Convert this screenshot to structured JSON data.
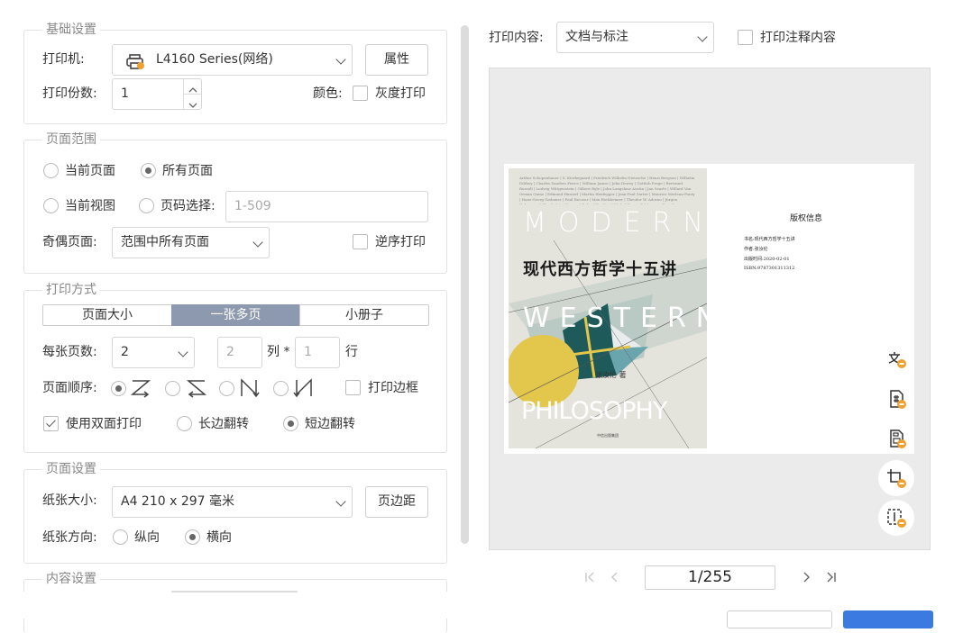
{
  "basic": {
    "legend": "基础设置",
    "printer_label": "打印机:",
    "printer_value": "L4160 Series(网络)",
    "properties_button": "属性",
    "copies_label": "打印份数:",
    "copies_value": "1",
    "color_label": "颜色:",
    "grayscale_label": "灰度打印"
  },
  "page_range": {
    "legend": "页面范围",
    "current_page": "当前页面",
    "all_pages": "所有页面",
    "current_view": "当前视图",
    "page_select": "页码选择:",
    "page_select_placeholder": "1-509",
    "odd_even_label": "奇偶页面:",
    "odd_even_value": "范围中所有页面",
    "reverse_label": "逆序打印"
  },
  "print_mode": {
    "legend": "打印方式",
    "tabs": [
      "页面大小",
      "一张多页",
      "小册子"
    ],
    "active_tab": "一张多页",
    "pages_per_sheet_label": "每张页数:",
    "pages_per_sheet_value": "2",
    "columns_value": "2",
    "columns_label": "列 *",
    "rows_value": "1",
    "rows_label": "行",
    "page_order_label": "页面顺序:",
    "print_border_label": "打印边框",
    "duplex_label": "使用双面打印",
    "long_edge_label": "长边翻转",
    "short_edge_label": "短边翻转"
  },
  "page_setup": {
    "legend": "页面设置",
    "paper_size_label": "纸张大小:",
    "paper_size_value": "A4 210 x 297 毫米",
    "margins_button": "页边距",
    "orientation_label": "纸张方向:",
    "portrait_label": "纵向",
    "landscape_label": "横向"
  },
  "content_settings": {
    "legend": "内容设置"
  },
  "preview": {
    "print_content_label": "打印内容:",
    "print_content_value": "文档与标注",
    "print_annotations_label": "打印注释内容",
    "page_indicator": "1/255",
    "copyright_title": "版权信息",
    "copyright_lines": [
      "书名:现代西方哲学十五讲",
      "作者:张汝伦",
      "出版时间:2020-02-01",
      "ISBN:9787301311312"
    ]
  },
  "cover": {
    "title_cn": "现代西方哲学十五讲",
    "word1": "MODERN",
    "word2": "WESTERN",
    "word3": "PHILOSOPHY",
    "author": "张汝伦 著",
    "publisher": "中信出版集团",
    "names_text": "Arthur Schopenhauer | S. Kierkegaard | Friedrich Wilhelm Nietzsche | Henri Bergson | Wilhelm Dilthey | Charles Sanders Peirce | William James | John Dewey | Gottlob Frege | Bertrand Russell | Ludwig Wittgenstein | Gilbert Ryle | John Langshaw Austin | Jan Searle | Willard Van Orman Quine | Edmund Husserl | Martin Heidegger | Jean-Paul Sartre | Maurice Merleau-Ponty | Hans-Georg Gadamer | Paul Ricoeur | Max Horkheimer | Theodor W. Adorno | Jürgen Habermas | Claude Lévi-Strauss | Roland Barthes | Michel Foucault | Jacques Derrida"
  },
  "colors": {
    "accent": "#8d99ae",
    "badge": "#f0a030",
    "primary_button": "#3b7ae0"
  }
}
